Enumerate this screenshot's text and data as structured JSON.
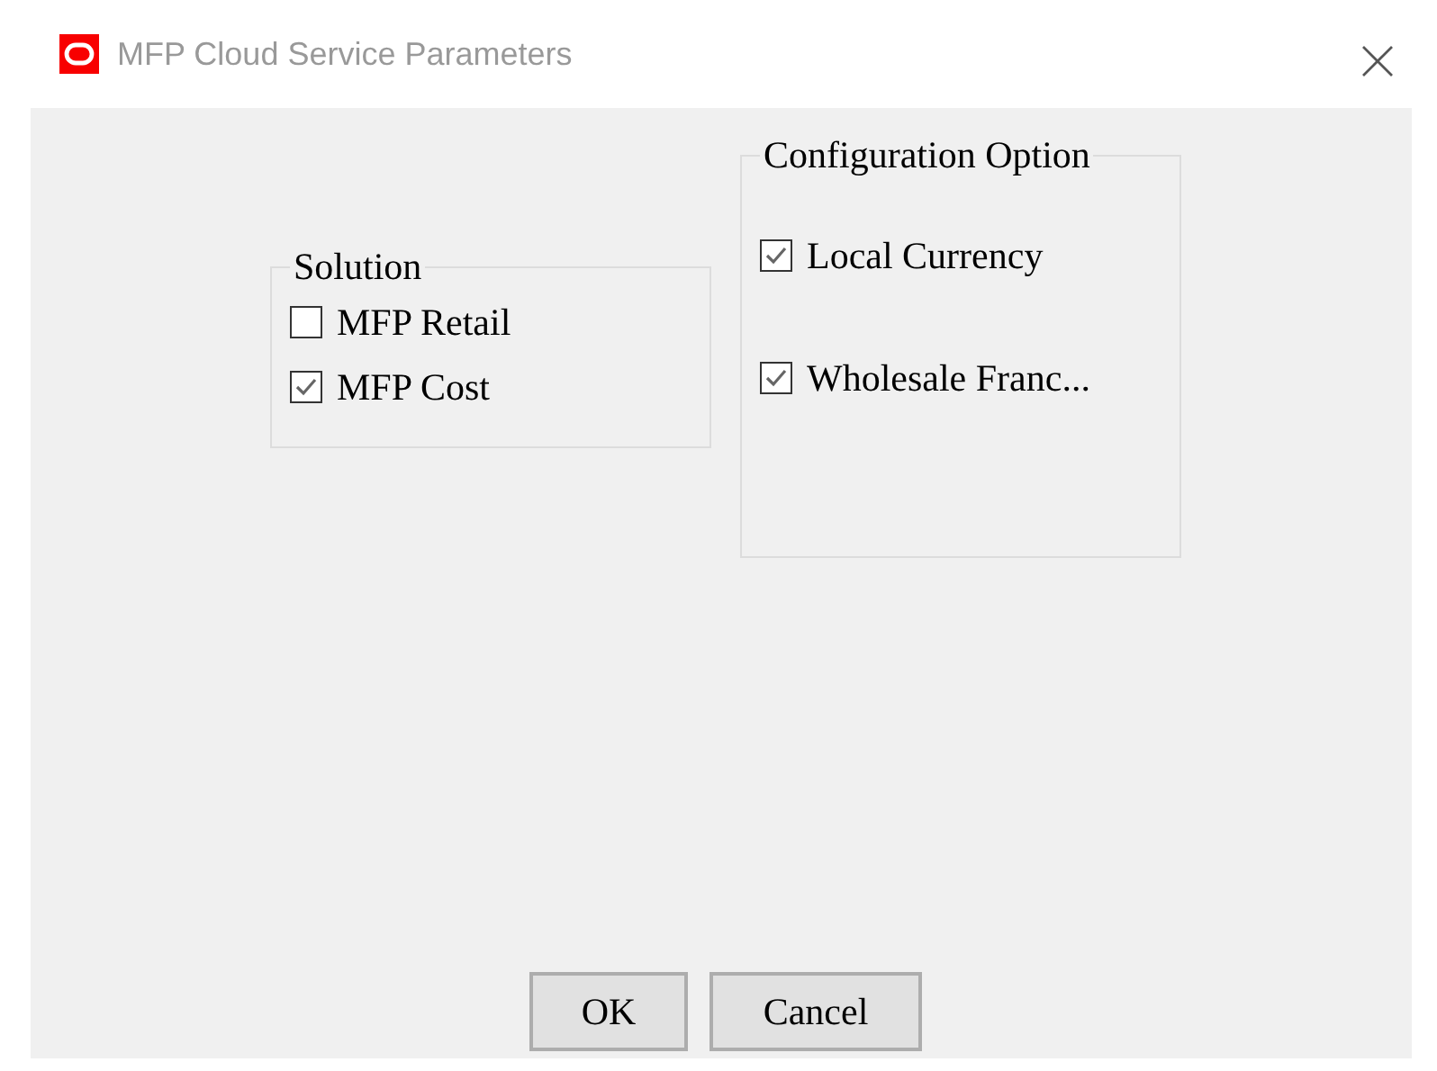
{
  "window": {
    "title": "MFP Cloud Service Parameters"
  },
  "groups": [
    {
      "title": "Solution",
      "options": [
        {
          "label": "MFP Retail",
          "checked": false
        },
        {
          "label": "MFP Cost",
          "checked": true
        }
      ]
    },
    {
      "title": "Configuration Option",
      "options": [
        {
          "label": "Local Currency",
          "checked": true
        },
        {
          "label": "Wholesale Franc...",
          "checked": true
        }
      ]
    }
  ],
  "buttons": [
    "OK",
    "Cancel"
  ]
}
